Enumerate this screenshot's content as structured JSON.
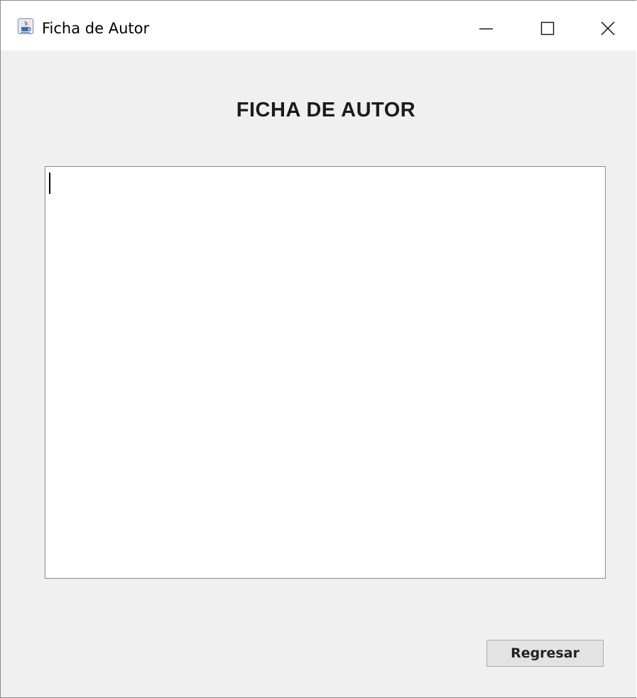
{
  "window": {
    "title": "Ficha de Autor",
    "app_icon": "java-coffee-cup-icon",
    "controls": {
      "minimize_icon": "minimize-icon",
      "maximize_icon": "maximize-icon",
      "close_icon": "close-icon"
    }
  },
  "main": {
    "heading": "FICHA DE AUTOR",
    "text_area_value": "",
    "back_button_label": "Regresar"
  },
  "colors": {
    "window_background": "#f0f0f0",
    "titlebar_background": "#ffffff",
    "text_area_background": "#ffffff",
    "button_background": "#e3e3e3"
  }
}
